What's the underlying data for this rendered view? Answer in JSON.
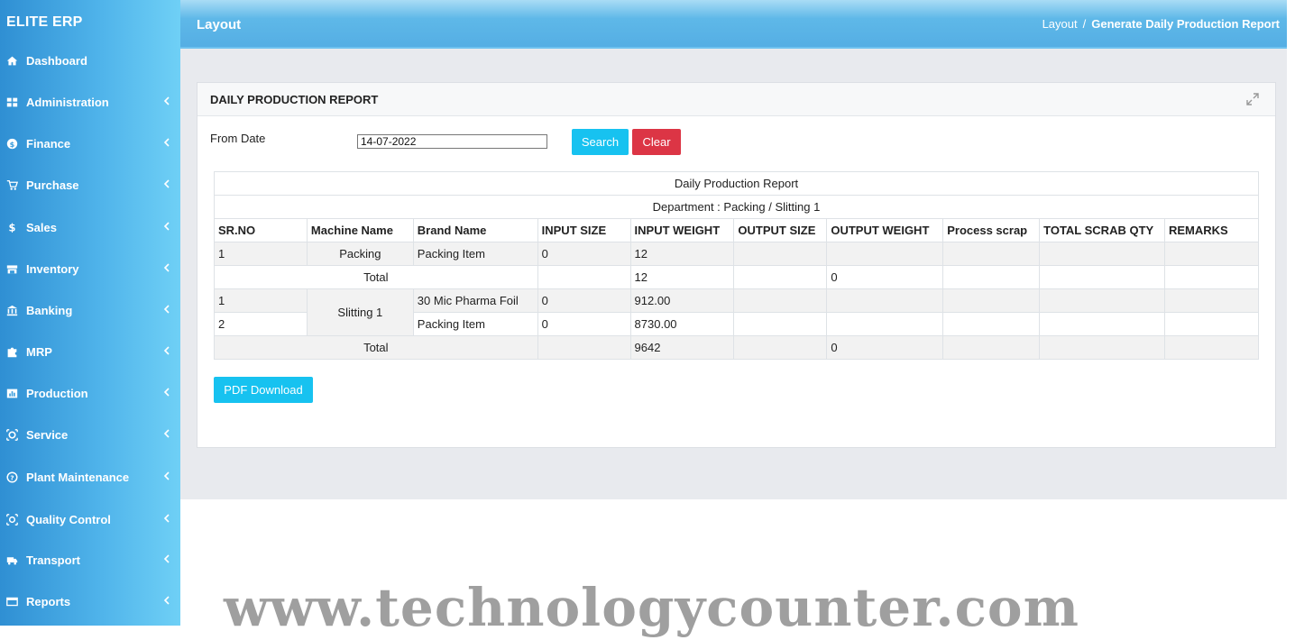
{
  "app": {
    "name": "ELITE ERP"
  },
  "sidebar": {
    "items": [
      {
        "label": "Dashboard",
        "icon": "home-icon",
        "has_submenu": false
      },
      {
        "label": "Administration",
        "icon": "grid-icon",
        "has_submenu": true
      },
      {
        "label": "Finance",
        "icon": "dollar-circle-icon",
        "has_submenu": true
      },
      {
        "label": "Purchase",
        "icon": "cart-icon",
        "has_submenu": true
      },
      {
        "label": "Sales",
        "icon": "dollar-icon",
        "has_submenu": true
      },
      {
        "label": "Inventory",
        "icon": "store-icon",
        "has_submenu": true
      },
      {
        "label": "Banking",
        "icon": "bank-icon",
        "has_submenu": true
      },
      {
        "label": "MRP",
        "icon": "puzzle-icon",
        "has_submenu": true
      },
      {
        "label": "Production",
        "icon": "chart-icon",
        "has_submenu": true
      },
      {
        "label": "Service",
        "icon": "service-icon",
        "has_submenu": true
      },
      {
        "label": "Plant Maintenance",
        "icon": "help-circle-icon",
        "has_submenu": true
      },
      {
        "label": "Quality Control",
        "icon": "scan-icon",
        "has_submenu": true
      },
      {
        "label": "Transport",
        "icon": "truck-icon",
        "has_submenu": true
      },
      {
        "label": "Reports",
        "icon": "report-icon",
        "has_submenu": true
      }
    ]
  },
  "header": {
    "title": "Layout",
    "breadcrumb": {
      "parent": "Layout",
      "separator": "/",
      "current": "Generate Daily Production Report"
    }
  },
  "card": {
    "title": "DAILY PRODUCTION REPORT"
  },
  "filters": {
    "from_date_label": "From Date",
    "from_date_value": "14-07-2022",
    "search_label": "Search",
    "clear_label": "Clear"
  },
  "report": {
    "title": "Daily Production Report",
    "department": "Department : Packing / Slitting 1",
    "columns": [
      "SR.NO",
      "Machine Name",
      "Brand Name",
      "INPUT SIZE",
      "INPUT WEIGHT",
      "OUTPUT SIZE",
      "OUTPUT WEIGHT",
      "Process scrap",
      "TOTAL SCRAB QTY",
      "REMARKS"
    ],
    "group1": {
      "machine": "Packing",
      "rows": [
        {
          "sr": "1",
          "brand": "Packing Item",
          "input_size": "0",
          "input_weight": "12"
        }
      ],
      "total_label": "Total",
      "total_input_weight": "12",
      "total_output_weight": "0"
    },
    "group2": {
      "machine": "Slitting 1",
      "rows": [
        {
          "sr": "1",
          "brand": "30 Mic Pharma Foil",
          "input_size": "0",
          "input_weight": "912.00"
        },
        {
          "sr": "2",
          "brand": "Packing Item",
          "input_size": "0",
          "input_weight": "8730.00"
        }
      ],
      "total_label": "Total",
      "total_input_weight": "9642",
      "total_output_weight": "0"
    }
  },
  "pdf_download_label": "PDF Download",
  "watermark": "www.technologycounter.com",
  "colors": {
    "sidebar_start": "#2f8fd3",
    "sidebar_end": "#6fd0f6",
    "primary_button": "#17c2f0",
    "danger_button": "#dc3545"
  }
}
